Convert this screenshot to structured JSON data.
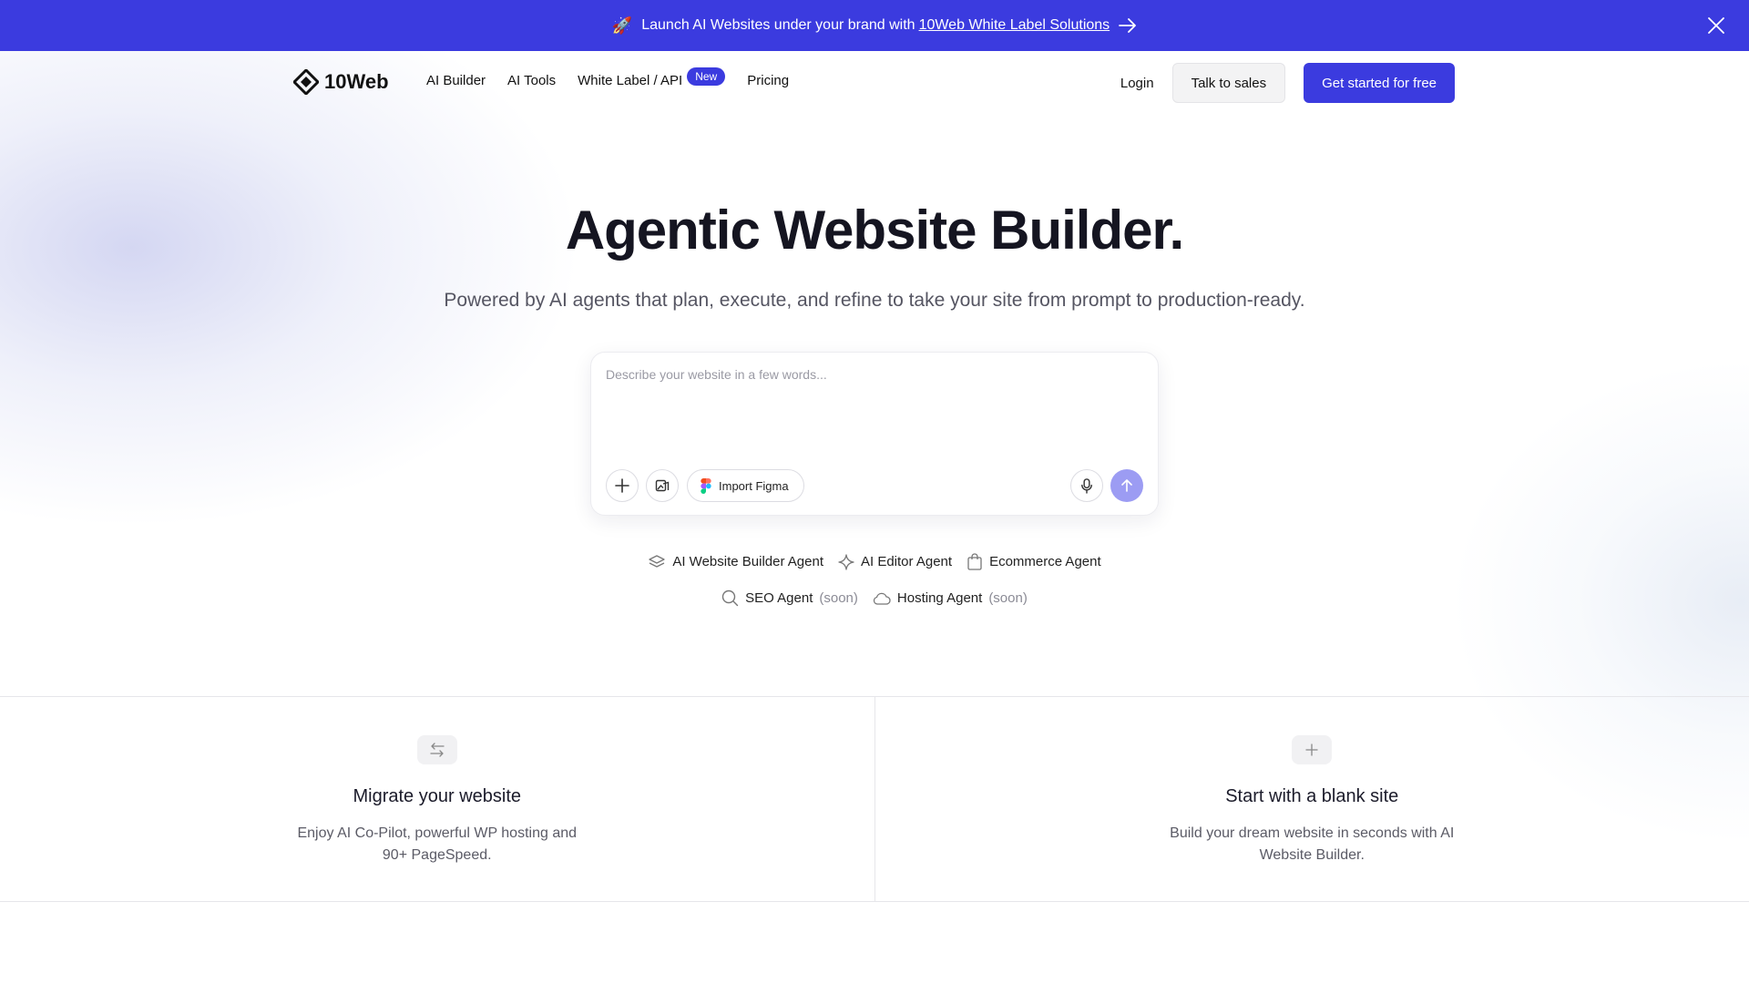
{
  "banner": {
    "rocket": "🚀",
    "text": "Launch AI Websites under your brand with",
    "link": "10Web White Label Solutions"
  },
  "nav": {
    "logo": "10Web",
    "links": [
      "AI Builder",
      "AI Tools",
      "White Label / API",
      "Pricing"
    ],
    "badge": "New",
    "login": "Login",
    "talk_to_sales": "Talk to sales",
    "get_started": "Get started for free"
  },
  "hero": {
    "title": "Agentic Website Builder.",
    "subtitle": "Powered by AI agents that plan, execute, and refine to take your site from prompt to production-ready."
  },
  "prompt": {
    "placeholder": "Describe your website in a few words...",
    "import_figma": "Import Figma"
  },
  "agents": {
    "row1": [
      "AI Website Builder Agent",
      "AI Editor Agent",
      "Ecommerce Agent"
    ],
    "row2": [
      "SEO Agent",
      "Hosting Agent"
    ],
    "soon": "(soon)"
  },
  "cards": [
    {
      "title": "Migrate your website",
      "desc": "Enjoy AI Co-Pilot, powerful WP hosting and 90+ PageSpeed."
    },
    {
      "title": "Start with a blank site",
      "desc": "Build your dream website in seconds with AI Website Builder."
    }
  ],
  "colors": {
    "brand": "#3b3bdf",
    "send": "#9c9cf3"
  }
}
